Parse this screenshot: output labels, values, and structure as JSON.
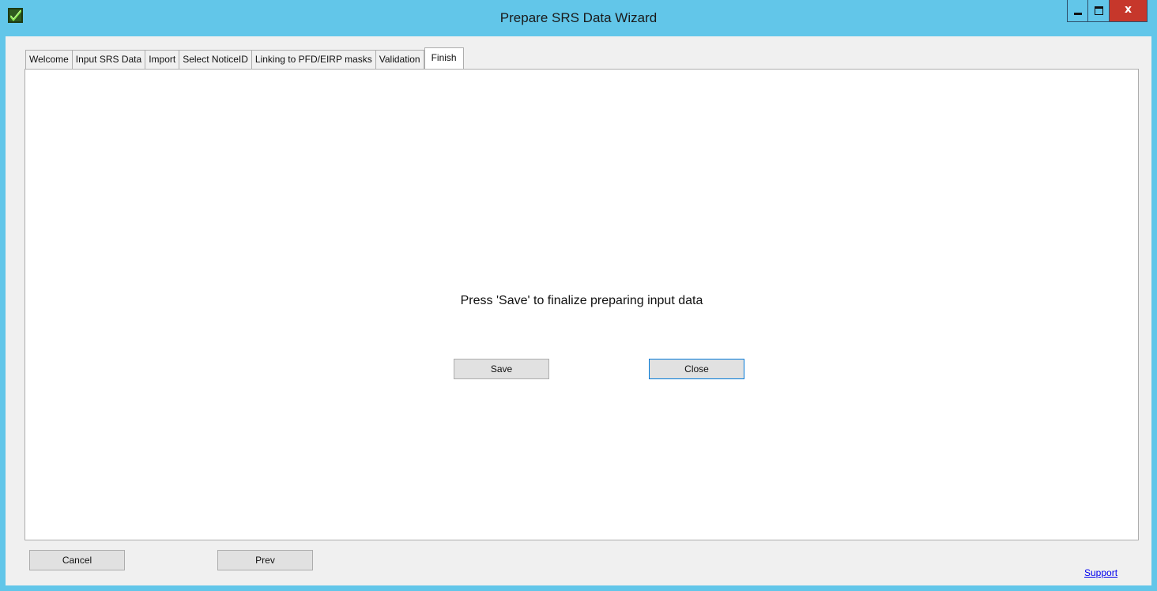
{
  "window": {
    "title": "Prepare SRS Data Wizard",
    "close_glyph": "x",
    "accent_color": "#62c6e9",
    "close_color": "#c6372b"
  },
  "tabs": [
    {
      "label": "Welcome"
    },
    {
      "label": "Input SRS Data"
    },
    {
      "label": "Import"
    },
    {
      "label": "Select NoticeID"
    },
    {
      "label": "Linking to PFD/EIRP masks"
    },
    {
      "label": "Validation"
    },
    {
      "label": "Finish",
      "active": true
    }
  ],
  "finish_page": {
    "message": "Press 'Save' to finalize preparing input data",
    "save_label": "Save",
    "close_label": "Close"
  },
  "footer": {
    "cancel_label": "Cancel",
    "prev_label": "Prev",
    "support_link": "Support"
  },
  "icons": {
    "app": "green-checkmark-icon",
    "minimize": "minimize-icon",
    "maximize": "maximize-icon",
    "close": "close-icon"
  }
}
